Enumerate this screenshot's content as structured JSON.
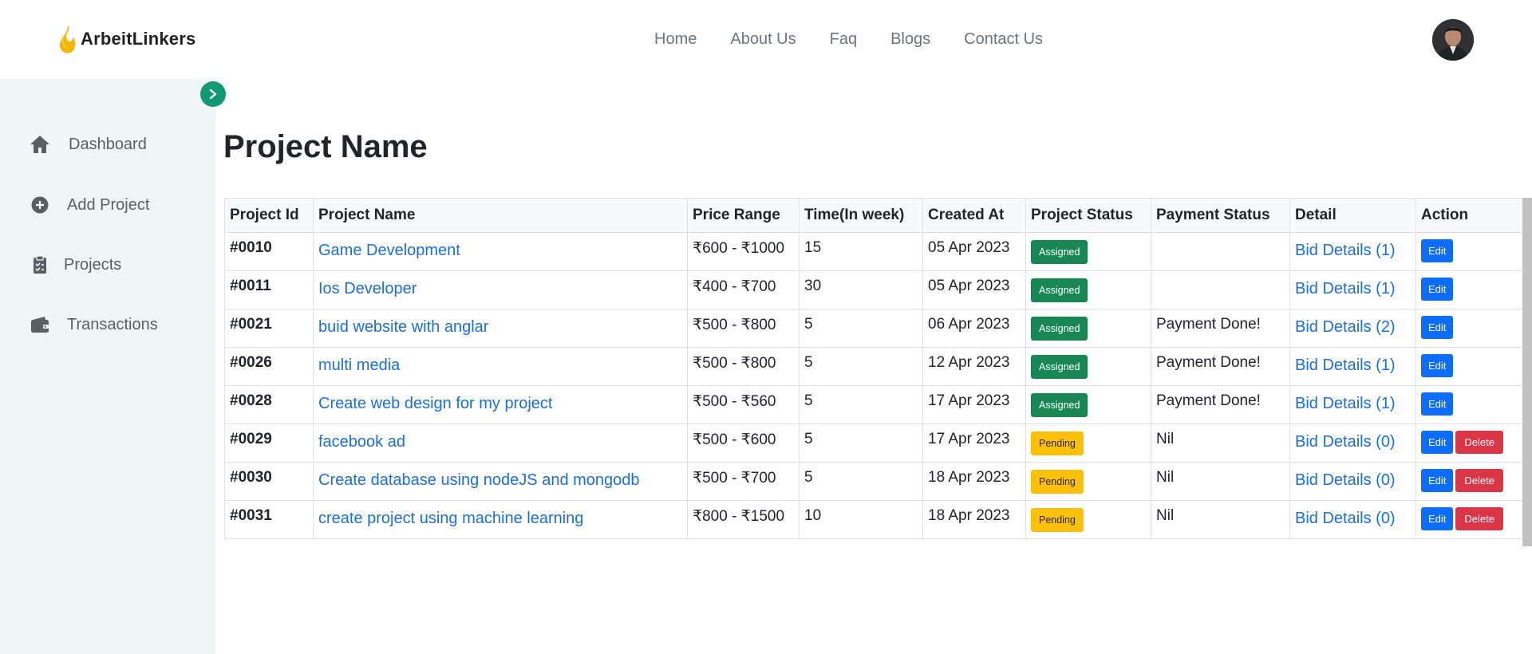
{
  "brand": {
    "name": "ArbeitLinkers"
  },
  "nav": [
    {
      "label": "Home"
    },
    {
      "label": "About Us"
    },
    {
      "label": "Faq"
    },
    {
      "label": "Blogs"
    },
    {
      "label": "Contact Us"
    }
  ],
  "sidebar": {
    "items": [
      {
        "label": "Dashboard",
        "icon": "home-icon"
      },
      {
        "label": "Add Project",
        "icon": "plus-circle-icon"
      },
      {
        "label": "Projects",
        "icon": "clipboard-icon"
      },
      {
        "label": "Transactions",
        "icon": "wallet-icon"
      }
    ]
  },
  "page": {
    "title": "Project Name"
  },
  "table": {
    "headers": [
      "Project Id",
      "Project Name",
      "Price Range",
      "Time(In week)",
      "Created At",
      "Project Status",
      "Payment Status",
      "Detail",
      "Action"
    ],
    "rows": [
      {
        "id": "#0010",
        "name": "Game Development",
        "price": "₹600 - ₹1000",
        "time": "15",
        "created": "05 Apr 2023",
        "status": "Assigned",
        "payment": "",
        "detail": "Bid Details (1)",
        "edit": "Edit"
      },
      {
        "id": "#0011",
        "name": "Ios Developer",
        "price": "₹400 - ₹700",
        "time": "30",
        "created": "05 Apr 2023",
        "status": "Assigned",
        "payment": "",
        "detail": "Bid Details (1)",
        "edit": "Edit"
      },
      {
        "id": "#0021",
        "name": "buid website with anglar",
        "price": "₹500 - ₹800",
        "time": "5",
        "created": "06 Apr 2023",
        "status": "Assigned",
        "payment": "Payment Done!",
        "detail": "Bid Details (2)",
        "edit": "Edit"
      },
      {
        "id": "#0026",
        "name": "multi media",
        "price": "₹500 - ₹800",
        "time": "5",
        "created": "12 Apr 2023",
        "status": "Assigned",
        "payment": "Payment Done!",
        "detail": "Bid Details (1)",
        "edit": "Edit"
      },
      {
        "id": "#0028",
        "name": "Create web design for my project",
        "price": "₹500 - ₹560",
        "time": "5",
        "created": "17 Apr 2023",
        "status": "Assigned",
        "payment": "Payment Done!",
        "detail": "Bid Details (1)",
        "edit": "Edit"
      },
      {
        "id": "#0029",
        "name": "facebook ad",
        "price": "₹500 - ₹600",
        "time": "5",
        "created": "17 Apr 2023",
        "status": "Pending",
        "payment": "Nil",
        "detail": "Bid Details (0)",
        "edit": "Edit",
        "delete": "Delete"
      },
      {
        "id": "#0030",
        "name": "Create database using nodeJS and mongodb",
        "price": "₹500 - ₹700",
        "time": "5",
        "created": "18 Apr 2023",
        "status": "Pending",
        "payment": "Nil",
        "detail": "Bid Details (0)",
        "edit": "Edit",
        "delete": "Delete"
      },
      {
        "id": "#0031",
        "name": "create project using machine learning",
        "price": "₹800 - ₹1500",
        "time": "10",
        "created": "18 Apr 2023",
        "status": "Pending",
        "payment": "Nil",
        "detail": "Bid Details (0)",
        "edit": "Edit",
        "delete": "Delete"
      }
    ]
  },
  "colors": {
    "accent_green": "#109977",
    "assigned": "#198754",
    "pending": "#ffc107",
    "link": "#1a6fdf",
    "edit": "#0d6efd",
    "delete": "#dc3545",
    "sidebar_bg": "#f0f5f8"
  }
}
